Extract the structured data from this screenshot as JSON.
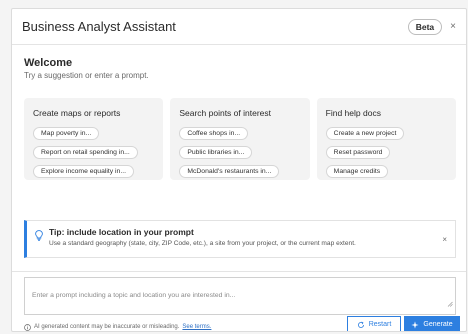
{
  "header": {
    "title": "Business Analyst Assistant",
    "badge": "Beta",
    "close_glyph": "×"
  },
  "welcome": {
    "title": "Welcome",
    "subtitle": "Try a suggestion or enter a prompt."
  },
  "cards": [
    {
      "title": "Create maps or reports",
      "chips": [
        "Map poverty in...",
        "Report on retail spending in...",
        "Explore income equality in..."
      ]
    },
    {
      "title": "Search points of interest",
      "chips": [
        "Coffee shops in...",
        "Public libraries in...",
        "McDonald's restaurants in..."
      ]
    },
    {
      "title": "Find help docs",
      "chips": [
        "Create a new project",
        "Reset password",
        "Manage credits"
      ]
    }
  ],
  "tip": {
    "icon": "lightbulb-icon",
    "title": "Tip: include location in your prompt",
    "text": "Use a standard geography (state, city, ZIP Code, etc.), a site from your project, or the current map extent.",
    "close_glyph": "×"
  },
  "prompt": {
    "value": "",
    "placeholder": "Enter a prompt including a topic and location you are interested in..."
  },
  "footer": {
    "disclaimer": "AI generated content may be inaccurate or misleading.",
    "terms_label": "See terms.",
    "restart_label": "Restart",
    "generate_label": "Generate"
  },
  "colors": {
    "accent": "#2d7fe0",
    "card_bg": "#f3f3f3",
    "text": "#323232"
  }
}
